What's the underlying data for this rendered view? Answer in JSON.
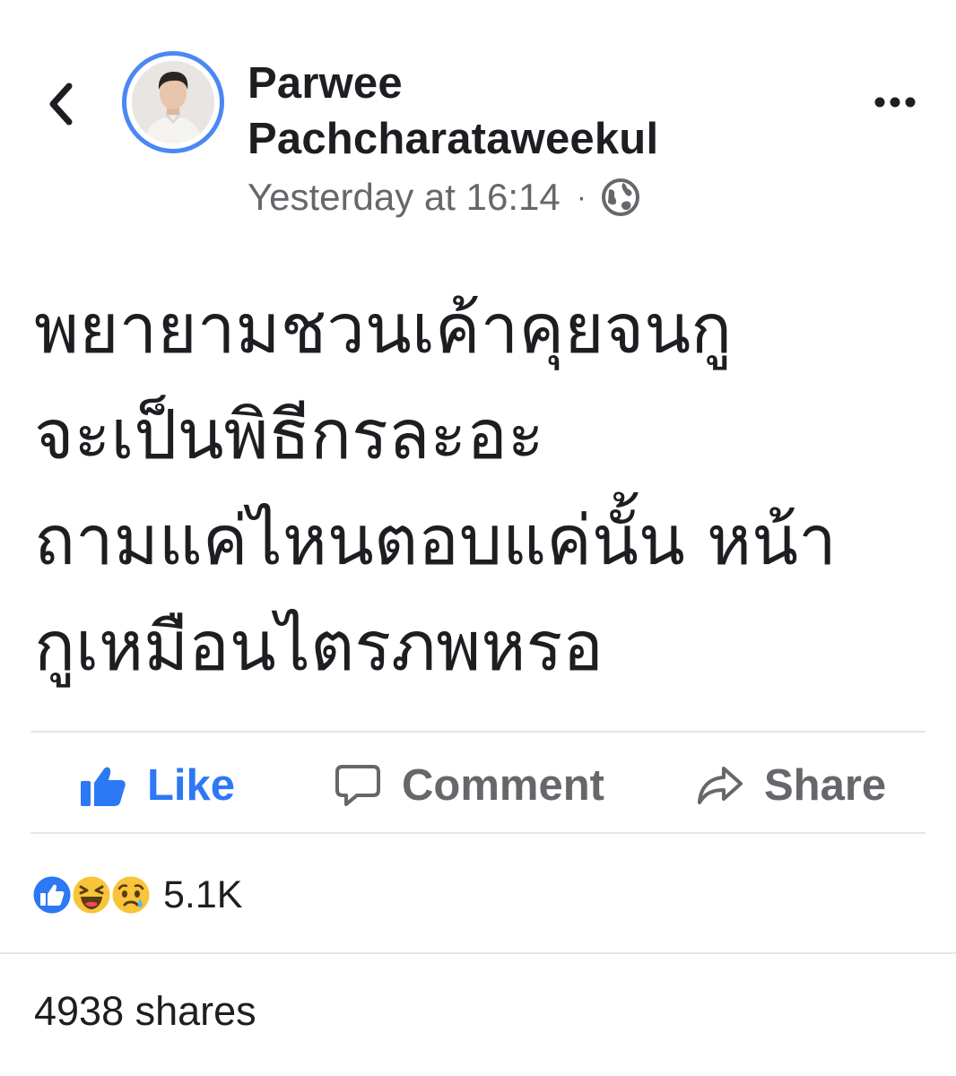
{
  "header": {
    "author_name": "Parwee Pachcharataweekul",
    "timestamp": "Yesterday at 16:14",
    "separator": "·",
    "privacy_icon": "globe-icon",
    "back_icon": "chevron-left-icon",
    "more_icon": "more-dots-icon"
  },
  "post": {
    "text": "พยายามชวนเค้าคุยจนกู\nจะเป็นพิธีกรละอะ\nถามแค่ไหนตอบแค่นั้น หน้า\nกูเหมือนไตรภพหรอ"
  },
  "actions": {
    "like_label": "Like",
    "comment_label": "Comment",
    "share_label": "Share"
  },
  "reactions": {
    "icons": [
      "like-reaction-icon",
      "haha-reaction-icon",
      "sad-reaction-icon"
    ],
    "count": "5.1K"
  },
  "shares": {
    "text": "4938 shares"
  },
  "colors": {
    "accent": "#2d78f4",
    "text_primary": "#1c1e21",
    "text_secondary": "#65676b",
    "divider": "#e4e6eb",
    "haha_yellow": "#f7c43a"
  }
}
